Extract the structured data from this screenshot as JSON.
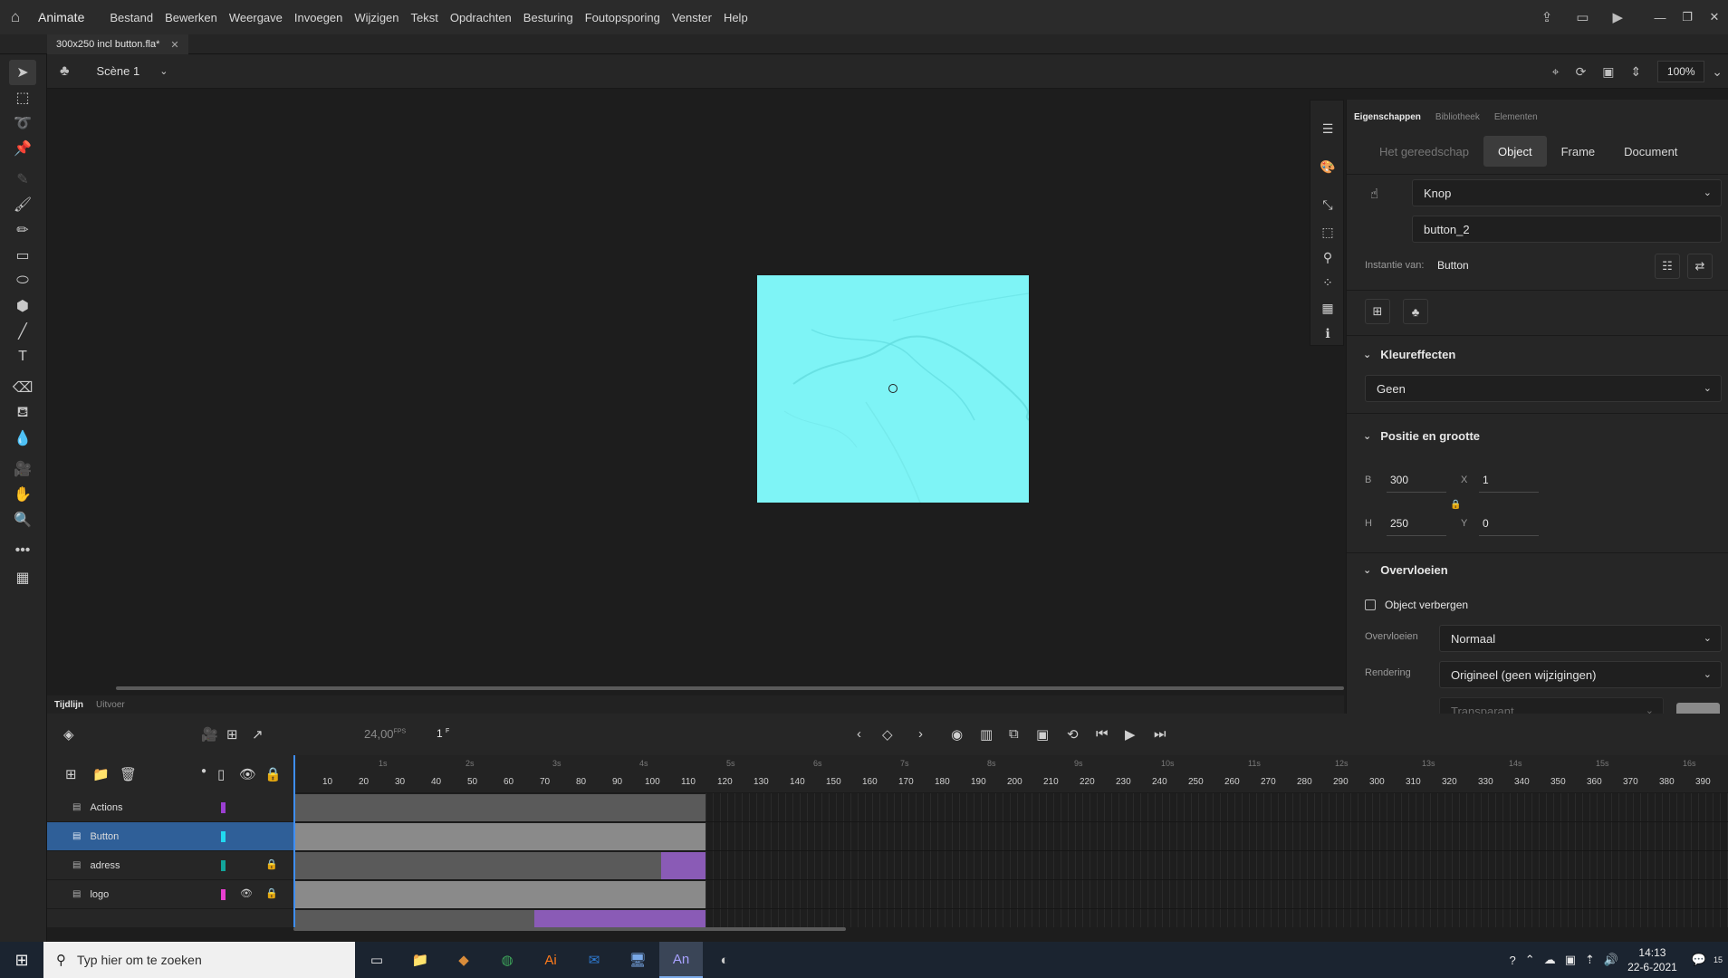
{
  "app": {
    "name": "Animate",
    "document_tab": "300x250 incl button.fla*"
  },
  "menu": [
    "Bestand",
    "Bewerken",
    "Weergave",
    "Invoegen",
    "Wijzigen",
    "Tekst",
    "Opdrachten",
    "Besturing",
    "Foutopsporing",
    "Venster",
    "Help"
  ],
  "scene": {
    "name": "Scène 1",
    "zoom": "100%"
  },
  "properties": {
    "tabs": [
      "Eigenschappen",
      "Bibliotheek",
      "Elementen"
    ],
    "mode_tabs": [
      "Het gereedschap",
      "Object",
      "Frame",
      "Document"
    ],
    "symbol_type": "Knop",
    "instance_name": "button_2",
    "instance_label": "Instantie van:",
    "instance_value": "Button",
    "color_effects_title": "Kleureffecten",
    "color_effect": "Geen",
    "pos_size_title": "Positie en grootte",
    "w_label": "B",
    "w": "300",
    "h_label": "H",
    "h": "250",
    "x_label": "X",
    "x": "1",
    "y_label": "Y",
    "y": "0",
    "blend_title": "Overvloeien",
    "hide_object": "Object verbergen",
    "blend_label": "Overvloeien",
    "blend_value": "Normaal",
    "render_label": "Rendering",
    "render_value": "Origineel (geen wijzigingen)",
    "transparent_value": "Transparant"
  },
  "timeline": {
    "tabs": [
      "Tijdlijn",
      "Uitvoer"
    ],
    "fps": "24,00",
    "fps_unit": "FPS",
    "frame": "1",
    "frame_unit": "F",
    "ruler": [
      "10",
      "20",
      "30",
      "40",
      "50",
      "60",
      "70",
      "80",
      "90",
      "100",
      "110",
      "120",
      "130",
      "140",
      "150",
      "160",
      "170",
      "180",
      "190",
      "200",
      "210",
      "220",
      "230",
      "240",
      "250",
      "260",
      "270",
      "280",
      "290",
      "300",
      "310",
      "320",
      "330",
      "340",
      "350",
      "360",
      "370",
      "380",
      "390"
    ],
    "seconds": [
      "1s",
      "2s",
      "3s",
      "4s",
      "5s",
      "6s",
      "7s",
      "8s",
      "9s",
      "10s",
      "11s",
      "12s",
      "13s",
      "14s",
      "15s",
      "16s"
    ],
    "layers": [
      {
        "name": "Actions",
        "color": "#9b3fd1"
      },
      {
        "name": "Button",
        "color": "#21d9f0"
      },
      {
        "name": "adress",
        "color": "#12a59b"
      },
      {
        "name": "logo",
        "color": "#e83fd0"
      }
    ]
  },
  "taskbar": {
    "search_placeholder": "Typ hier om te zoeken",
    "time": "14:13",
    "date": "22-6-2021",
    "notif_count": "15"
  }
}
